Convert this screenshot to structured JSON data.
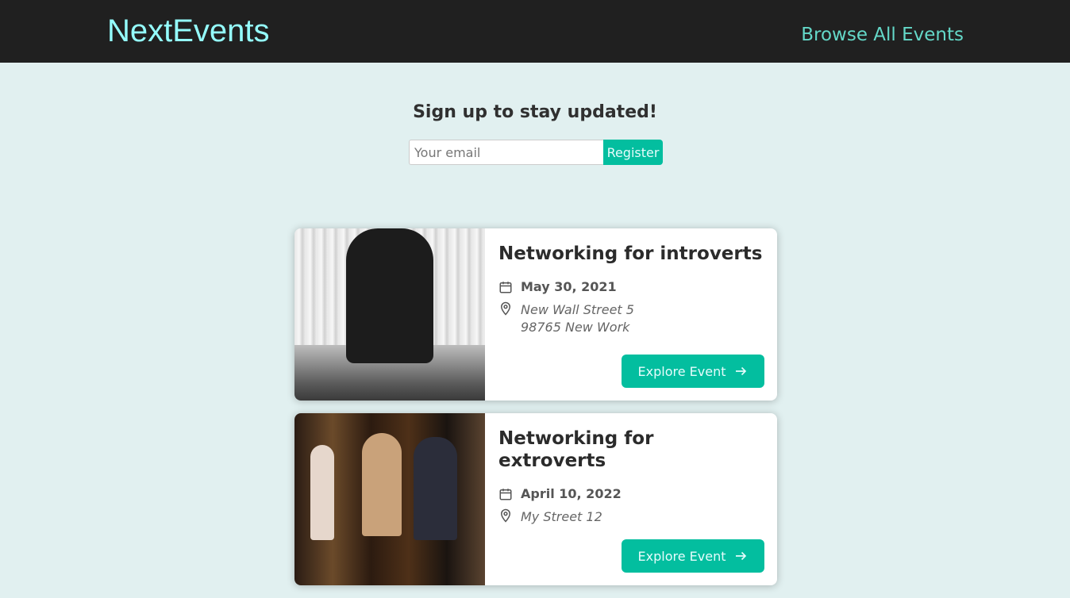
{
  "header": {
    "logo": "NextEvents",
    "nav_link": "Browse All Events"
  },
  "signup": {
    "heading": "Sign up to stay updated!",
    "email_placeholder": "Your email",
    "email_value": "",
    "register_label": "Register"
  },
  "events": [
    {
      "title": "Networking for introverts",
      "date": "May 30, 2021",
      "address_line1": "New Wall Street 5",
      "address_line2": "98765 New Work",
      "button_label": "Explore Event"
    },
    {
      "title": "Networking for extroverts",
      "date": "April 10, 2022",
      "address_line1": "My Street 12",
      "address_line2": "",
      "button_label": "Explore Event"
    }
  ],
  "colors": {
    "header_bg": "#202020",
    "logo": "#94fdfd",
    "nav_link": "#64d8c8",
    "page_bg": "#e1f0f0",
    "accent": "#03be9f"
  },
  "icons": {
    "date": "calendar-icon",
    "address": "location-pin-icon",
    "button": "arrow-right-icon"
  }
}
